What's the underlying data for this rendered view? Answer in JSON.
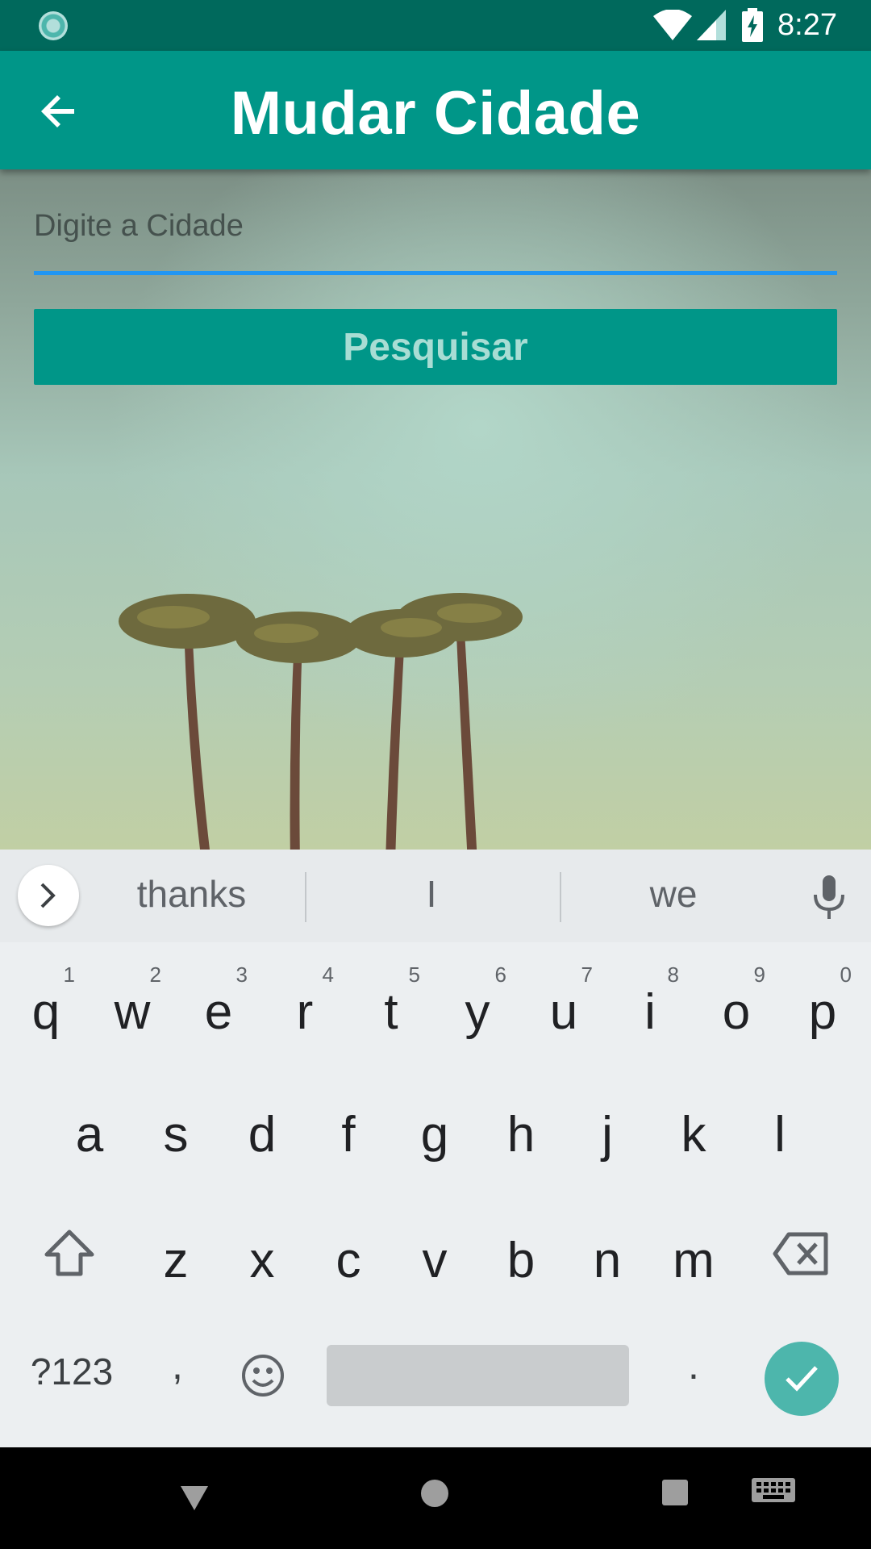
{
  "status_bar": {
    "time": "8:27",
    "icons": [
      "sync-icon",
      "wifi-icon",
      "signal-icon",
      "battery-charging-icon"
    ]
  },
  "app_bar": {
    "title": "Mudar Cidade",
    "back_icon": "arrow-back-icon"
  },
  "form": {
    "city_placeholder": "Digite a Cidade",
    "city_value": "",
    "search_label": "Pesquisar"
  },
  "colors": {
    "status_bar": "#00695c",
    "primary": "#009688",
    "input_underline": "#2196f3",
    "enter_key": "#4db6ac"
  },
  "keyboard": {
    "suggestions": [
      "thanks",
      "I",
      "we"
    ],
    "row1": [
      {
        "key": "q",
        "num": "1"
      },
      {
        "key": "w",
        "num": "2"
      },
      {
        "key": "e",
        "num": "3"
      },
      {
        "key": "r",
        "num": "4"
      },
      {
        "key": "t",
        "num": "5"
      },
      {
        "key": "y",
        "num": "6"
      },
      {
        "key": "u",
        "num": "7"
      },
      {
        "key": "i",
        "num": "8"
      },
      {
        "key": "o",
        "num": "9"
      },
      {
        "key": "p",
        "num": "0"
      }
    ],
    "row2": [
      "a",
      "s",
      "d",
      "f",
      "g",
      "h",
      "j",
      "k",
      "l"
    ],
    "row3": [
      "z",
      "x",
      "c",
      "v",
      "b",
      "n",
      "m"
    ],
    "symbols_label": "?123",
    "comma_label": ",",
    "period_label": "."
  },
  "nav_bar": {
    "icons": [
      "nav-back-icon",
      "nav-home-icon",
      "nav-recents-icon",
      "keyboard-switch-icon"
    ]
  }
}
